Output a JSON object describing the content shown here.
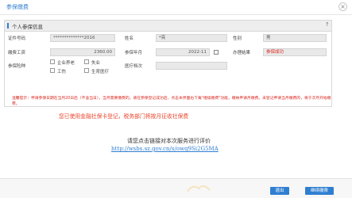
{
  "window": {
    "title": "参保缴费",
    "close_symbol": "×"
  },
  "panel": {
    "title": "个人参保信息",
    "collapse_symbol": "↑"
  },
  "form": {
    "id_label": "证件号码",
    "id_value": "**************2016",
    "name_label": "姓名",
    "name_value": "*亮",
    "gender_label": "性别",
    "gender_value": "男",
    "base_label": "缴费工资",
    "base_value": "2360.00",
    "period_label": "参保年月",
    "period_value": "2022-11",
    "status_label": "办理结果",
    "status_value": "参保成功",
    "insurance_label": "参保险种",
    "option_pension": "企业养老",
    "option_unemployment": "失业",
    "option_injury": "工伤",
    "option_medical": "生育医疗",
    "type_label": "医疗档次",
    "type_value": ""
  },
  "notice": "温馨提示：申请参保日期在当月20日后（不含当日），当月需要缴费的，请在参保登记成功后，点击本界面右下角\"继续缴费\"功能，缴纳申请月缴费。未登记申请当月缴费的，将于次月开始缴费。",
  "tip": "您已使用金融社保卡登记，税务部门将按月征收社保费",
  "survey_text": "请您点击链接对本次服务进行评价",
  "survey_link": "http://wsbs.sz.gov.cn/s/owq9Si2G5MA",
  "buttons": {
    "exit": "退出",
    "continue": "继续缴费"
  },
  "colors": {
    "accent": "#2f7fd1",
    "warning": "#d9251d",
    "tip": "#e8452c"
  }
}
